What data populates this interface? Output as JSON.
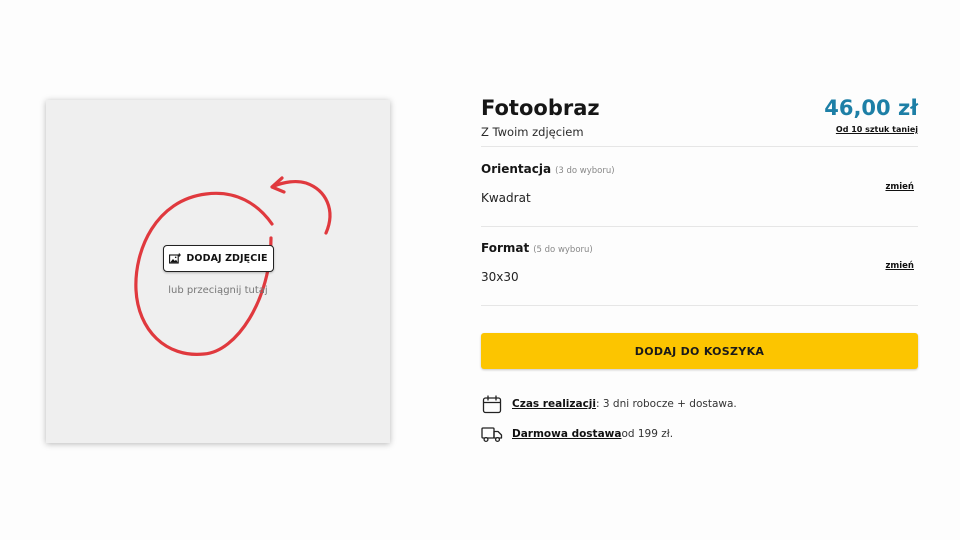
{
  "upload": {
    "button_label": "DODAJ ZDJĘCIE",
    "button_icon": "add-image-icon",
    "drag_hint": "lub przeciągnij tutaj",
    "annotation_color": "#e0393e"
  },
  "product": {
    "title": "Fotoobraz",
    "subtitle": "Z Twoim zdjęciem",
    "price": "46,00 zł",
    "price_color": "#1d7fa6",
    "bulk_discount_link": "Od 10 sztuk taniej"
  },
  "options": [
    {
      "label": "Orientacja",
      "count": "(3 do wyboru)",
      "value": "Kwadrat",
      "change_label": "zmień"
    },
    {
      "label": "Format",
      "count": "(5 do wyboru)",
      "value": "30x30",
      "change_label": "zmień"
    }
  ],
  "cart": {
    "button_label": "DODAJ DO KOSZYKA",
    "button_color": "#fcc500"
  },
  "info": [
    {
      "icon": "calendar-icon",
      "link": "Czas realizacji",
      "text": ": 3 dni robocze + dostawa."
    },
    {
      "icon": "delivery-truck-icon",
      "link": "Darmowa dostawa",
      "text": " od 199 zł."
    }
  ]
}
